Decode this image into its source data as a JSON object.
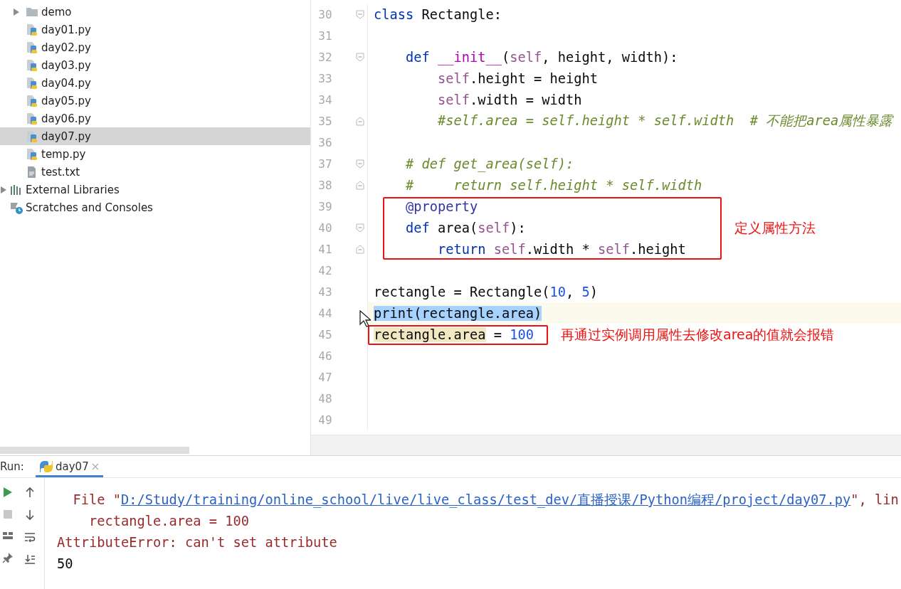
{
  "sidebar": {
    "project_items": [
      {
        "label": "demo",
        "kind": "folder",
        "expanded": false,
        "selected": false
      },
      {
        "label": "day01.py",
        "kind": "python",
        "selected": false
      },
      {
        "label": "day02.py",
        "kind": "python",
        "selected": false
      },
      {
        "label": "day03.py",
        "kind": "python",
        "selected": false
      },
      {
        "label": "day04.py",
        "kind": "python",
        "selected": false
      },
      {
        "label": "day05.py",
        "kind": "python",
        "selected": false
      },
      {
        "label": "day06.py",
        "kind": "python",
        "selected": false
      },
      {
        "label": "day07.py",
        "kind": "python",
        "selected": true
      },
      {
        "label": "temp.py",
        "kind": "python",
        "selected": false
      },
      {
        "label": "test.txt",
        "kind": "text",
        "selected": false
      }
    ],
    "top_items": [
      {
        "label": "External Libraries",
        "kind": "libraries",
        "expanded": false
      },
      {
        "label": "Scratches and Consoles",
        "kind": "scratches"
      }
    ]
  },
  "editor": {
    "lines": [
      {
        "number": "30",
        "fold_start": true,
        "tokens": [
          {
            "text": "class",
            "kind": "kw"
          },
          {
            "text": " Rectangle:",
            "kind": "plain"
          }
        ]
      },
      {
        "number": "31"
      },
      {
        "number": "32",
        "fold_start": true,
        "tokens": [
          {
            "text": "    def",
            "kind": "kw"
          },
          {
            "text": " __init__",
            "kind": "magic"
          },
          {
            "text": "(",
            "kind": "plain"
          },
          {
            "text": "self",
            "kind": "self"
          },
          {
            "text": ", height, width):",
            "kind": "plain"
          }
        ]
      },
      {
        "number": "33",
        "tokens": [
          {
            "text": "        self",
            "kind": "self"
          },
          {
            "text": ".height = height",
            "kind": "plain"
          }
        ]
      },
      {
        "number": "34",
        "tokens": [
          {
            "text": "        self",
            "kind": "self"
          },
          {
            "text": ".width = width",
            "kind": "plain"
          }
        ]
      },
      {
        "number": "35",
        "fold_end": true,
        "tokens": [
          {
            "text": "        #self.area = self.height * self.width  # 不能把area属性暴露",
            "kind": "comment"
          }
        ]
      },
      {
        "number": "36"
      },
      {
        "number": "37",
        "fold_start": true,
        "tokens": [
          {
            "text": "    # def get_area(self):",
            "kind": "comment"
          }
        ]
      },
      {
        "number": "38",
        "fold_end": true,
        "tokens": [
          {
            "text": "    #     return self.height * self.width",
            "kind": "comment"
          }
        ]
      },
      {
        "number": "39",
        "boxed": true,
        "tokens": [
          {
            "text": "    @property",
            "kind": "deco"
          }
        ]
      },
      {
        "number": "40",
        "fold_start": true,
        "boxed": true,
        "note": "定义属性方法",
        "tokens": [
          {
            "text": "    def",
            "kind": "kw"
          },
          {
            "text": " area(",
            "kind": "plain"
          },
          {
            "text": "self",
            "kind": "self"
          },
          {
            "text": "):",
            "kind": "plain"
          }
        ]
      },
      {
        "number": "41",
        "fold_end": true,
        "boxed": true,
        "tokens": [
          {
            "text": "        return",
            "kind": "kw"
          },
          {
            "text": " self",
            "kind": "self"
          },
          {
            "text": ".width * ",
            "kind": "plain"
          },
          {
            "text": "self",
            "kind": "self"
          },
          {
            "text": ".height",
            "kind": "plain"
          }
        ]
      },
      {
        "number": "42"
      },
      {
        "number": "43",
        "tokens": [
          {
            "text": "rectangle = Rectangle(",
            "kind": "plain"
          },
          {
            "text": "10",
            "kind": "num"
          },
          {
            "text": ", ",
            "kind": "plain"
          },
          {
            "text": "5",
            "kind": "num"
          },
          {
            "text": ")",
            "kind": "plain"
          }
        ]
      },
      {
        "number": "44",
        "current": true,
        "tokens": [
          {
            "text": "print(rectangle.area)",
            "kind": "selected"
          }
        ]
      },
      {
        "number": "45",
        "boxed": true,
        "note": "再通过实例调用属性去修改area的值就会报错",
        "tokens": [
          {
            "text": "rectangle.area",
            "kind": "usage"
          },
          {
            "text": " = ",
            "kind": "plain"
          },
          {
            "text": "100",
            "kind": "num"
          }
        ]
      },
      {
        "number": "46"
      },
      {
        "number": "47"
      },
      {
        "number": "48"
      },
      {
        "number": "49"
      }
    ]
  },
  "run_panel": {
    "label": "Run:",
    "tabs": [
      {
        "label": "day07",
        "selected": true
      }
    ],
    "console": [
      {
        "kind": "link",
        "prefix": "  File \"",
        "link": "D:/Study/training/online_school/live/live_class/test_dev/直播授课/Python编程/project/day07.py",
        "suffix": "\", lin"
      },
      {
        "kind": "error",
        "text": "    rectangle.area = 100"
      },
      {
        "kind": "error",
        "text": "AttributeError: can't set attribute"
      },
      {
        "kind": "output",
        "text": "50"
      }
    ]
  }
}
